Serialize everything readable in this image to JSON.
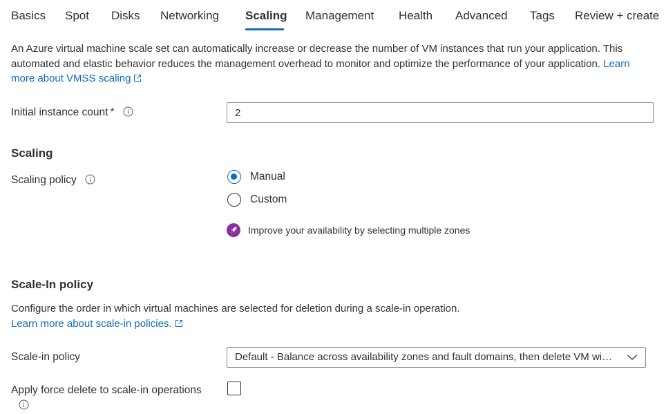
{
  "tabs": [
    {
      "label": "Basics"
    },
    {
      "label": "Spot"
    },
    {
      "label": "Disks"
    },
    {
      "label": "Networking"
    },
    {
      "label": "Scaling",
      "active": true
    },
    {
      "label": "Management"
    },
    {
      "label": "Health"
    },
    {
      "label": "Advanced"
    },
    {
      "label": "Tags"
    },
    {
      "label": "Review + create"
    }
  ],
  "intro": {
    "text": "An Azure virtual machine scale set can automatically increase or decrease the number of VM instances that run your application. This automated and elastic behavior reduces the management overhead to monitor and optimize the performance of your application.",
    "link": "Learn more about VMSS scaling"
  },
  "instance_count": {
    "label": "Initial instance count",
    "required_mark": "*",
    "value": "2"
  },
  "scaling": {
    "heading": "Scaling",
    "policy_label": "Scaling policy",
    "options": [
      {
        "label": "Manual",
        "selected": true
      },
      {
        "label": "Custom",
        "selected": false
      }
    ],
    "notice": "Improve your availability by selecting multiple zones"
  },
  "scale_in": {
    "heading": "Scale-In policy",
    "description": "Configure the order in which virtual machines are selected for deletion during a scale-in operation.",
    "link": "Learn more about scale-in policies.",
    "policy_label": "Scale-in policy",
    "policy_value": "Default - Balance across availability zones and fault domains, then delete VM with highest instance ID",
    "force_delete_label": "Apply force delete to scale-in operations",
    "force_delete_checked": false
  },
  "colors": {
    "accent": "#0f6cbd",
    "required": "#a4262c",
    "notice_badge": "#8a2da5"
  }
}
